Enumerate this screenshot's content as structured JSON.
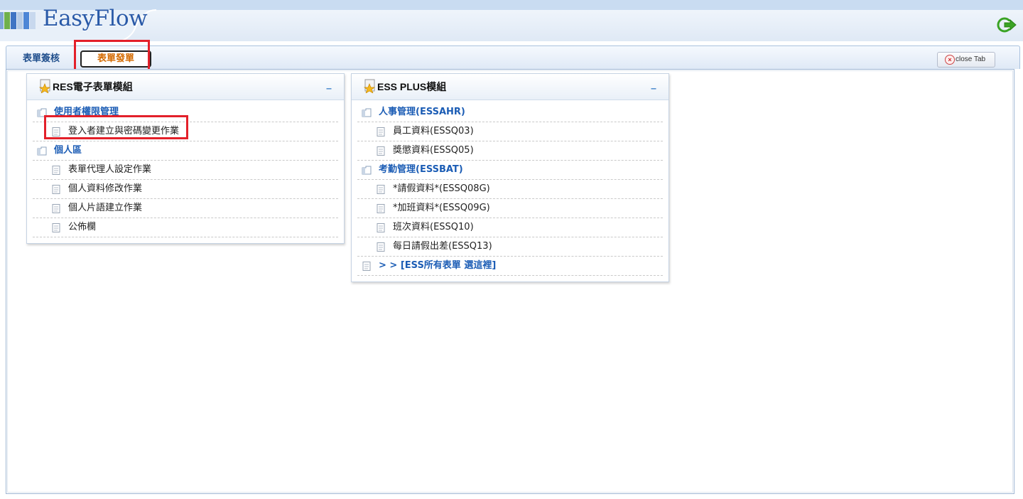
{
  "app": {
    "logo_text": "EasyFlow",
    "logout_icon": "logout-arrow-icon",
    "accent_color": "#1c5db5",
    "active_tab_color": "#d46a00",
    "highlight_color": "#e3202a"
  },
  "tabs": [
    {
      "label": "表單簽核",
      "active": false
    },
    {
      "label": "表單發單",
      "active": true
    }
  ],
  "close_tab_label": "close Tab",
  "panels": [
    {
      "title": "RES電子表單模組",
      "minimize_label": "_",
      "rows": [
        {
          "type": "category",
          "label": "使用者權限管理"
        },
        {
          "type": "item",
          "label": "登入者建立與密碼變更作業",
          "highlighted": true
        },
        {
          "type": "category",
          "label": "個人區"
        },
        {
          "type": "item",
          "label": "表單代理人設定作業"
        },
        {
          "type": "item",
          "label": "個人資料修改作業"
        },
        {
          "type": "item",
          "label": "個人片語建立作業"
        },
        {
          "type": "item",
          "label": "公佈欄"
        }
      ]
    },
    {
      "title": "ESS PLUS模組",
      "minimize_label": "_",
      "rows": [
        {
          "type": "category",
          "label": "人事管理(ESSAHR)"
        },
        {
          "type": "item",
          "label": "員工資料(ESSQ03)"
        },
        {
          "type": "item",
          "label": "獎懲資料(ESSQ05)"
        },
        {
          "type": "category",
          "label": "考勤管理(ESSBAT)"
        },
        {
          "type": "item",
          "label": "*請假資料*(ESSQ08G)"
        },
        {
          "type": "item",
          "label": "*加班資料*(ESSQ09G)"
        },
        {
          "type": "item",
          "label": "班次資料(ESSQ10)"
        },
        {
          "type": "item",
          "label": "每日請假出差(ESSQ13)"
        },
        {
          "type": "link",
          "label": "> >  [ESS所有表單 選這裡]"
        }
      ]
    }
  ]
}
